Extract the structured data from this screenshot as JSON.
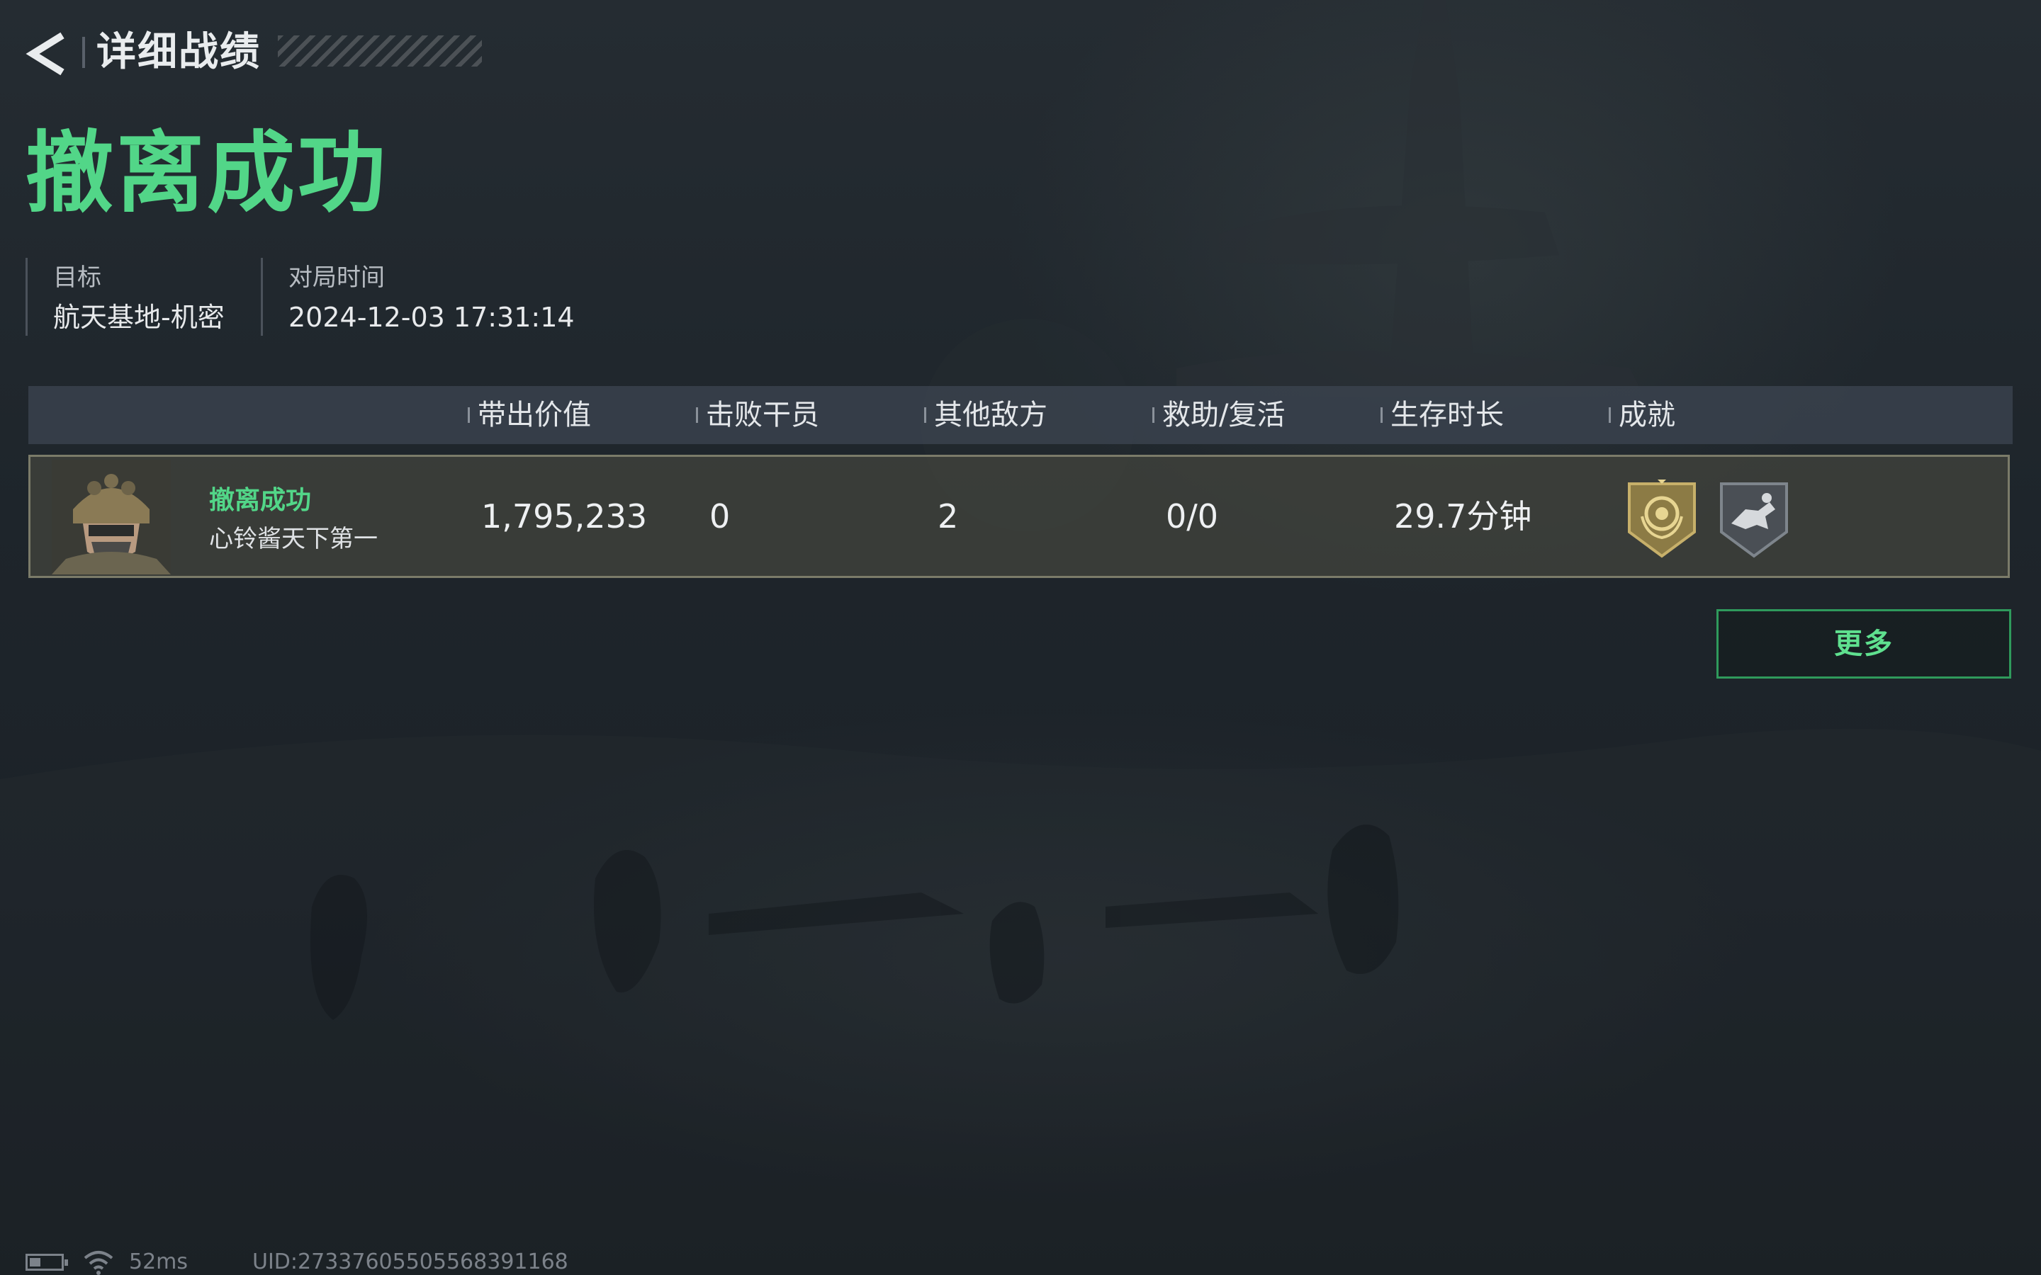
{
  "header": {
    "title": "详细战绩"
  },
  "result": {
    "title": "撤离成功",
    "title_color": "#52d688"
  },
  "info": {
    "target_label": "目标",
    "target_value": "航天基地-机密",
    "time_label": "对局时间",
    "time_value": "2024-12-03 17:31:14"
  },
  "table": {
    "columns": [
      "带出价值",
      "击败干员",
      "其他敌方",
      "救助/复活",
      "生存时长",
      "成就"
    ],
    "rows": [
      {
        "status": "撤离成功",
        "player_name": "心铃酱天下第一",
        "value": "1,795,233",
        "operators_defeated": "0",
        "other_enemies": "2",
        "assist_revive": "0/0",
        "survival_time": "29.7分钟",
        "achievements": [
          "gold-laurel-badge-icon",
          "gray-runner-badge-icon"
        ]
      }
    ]
  },
  "more_button": "更多",
  "status_bar": {
    "battery_level": 0.35,
    "ping": "52ms",
    "uid": "UID:2733760550556839116​8"
  }
}
